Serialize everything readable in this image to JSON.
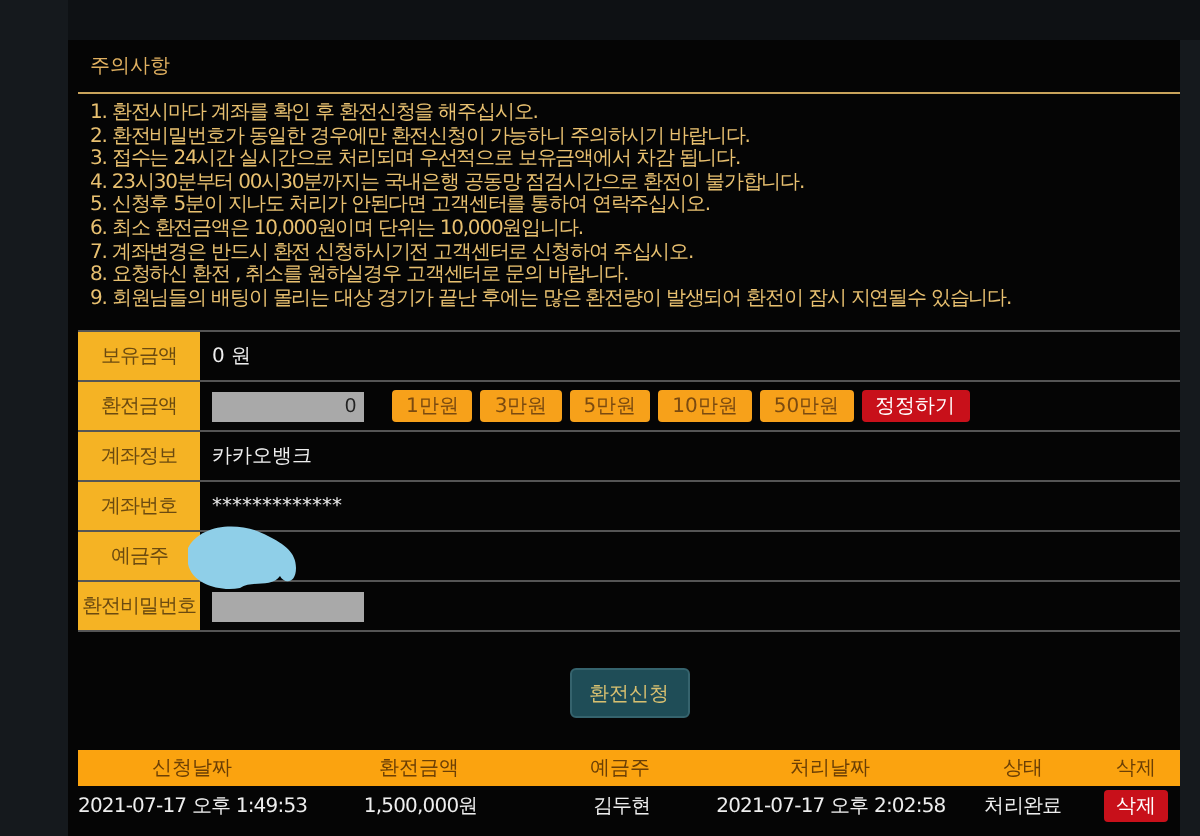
{
  "notice": {
    "title": "주의사항",
    "items": [
      "1. 환전시마다 계좌를 확인 후 환전신청을 해주십시오.",
      "2. 환전비밀번호가 동일한 경우에만 환전신청이 가능하니 주의하시기 바랍니다.",
      "3. 접수는 24시간 실시간으로 처리되며 우선적으로 보유금액에서 차감 됩니다.",
      "4. 23시30분부터 00시30분까지는 국내은행 공동망 점검시간으로 환전이 불가합니다.",
      "5. 신청후 5분이 지나도 처리가 안된다면 고객센터를 통하여 연락주십시오.",
      "6. 최소 환전금액은 10,000원이며 단위는 10,000원입니다.",
      "7. 계좌변경은 반드시 환전 신청하시기전 고객센터로 신청하여 주십시오.",
      "8. 요청하신 환전 , 취소를 원하실경우 고객센터로 문의 바랍니다.",
      "9. 회원님들의 배팅이 몰리는 대상 경기가 끝난 후에는 많은 환전량이 발생되어 환전이 잠시 지연될수 있습니다."
    ]
  },
  "form": {
    "rows": [
      {
        "label": "보유금액",
        "kind": "text",
        "value": "0 원"
      },
      {
        "label": "환전금액",
        "kind": "amount",
        "value": "0",
        "buttons": [
          {
            "label": "1만원",
            "kind": "add"
          },
          {
            "label": "3만원",
            "kind": "add"
          },
          {
            "label": "5만원",
            "kind": "add"
          },
          {
            "label": "10만원",
            "kind": "add"
          },
          {
            "label": "50만원",
            "kind": "add"
          },
          {
            "label": "정정하기",
            "kind": "reset"
          }
        ]
      },
      {
        "label": "계좌정보",
        "kind": "text",
        "value": "카카오뱅크"
      },
      {
        "label": "계좌번호",
        "kind": "text",
        "value": "*************"
      },
      {
        "label": "예금주",
        "kind": "redacted"
      },
      {
        "label": "환전비밀번호",
        "kind": "password"
      }
    ]
  },
  "submit": "환전신청",
  "history": {
    "columns": [
      "신청날짜",
      "환전금액",
      "예금주",
      "처리날짜",
      "상태",
      "삭제"
    ],
    "rows": [
      {
        "cells": [
          "2021-07-17 오후 1:49:53",
          "1,500,000원",
          "김두현",
          "2021-07-17 오후 2:02:58",
          "처리완료"
        ],
        "action": "삭제"
      }
    ]
  }
}
